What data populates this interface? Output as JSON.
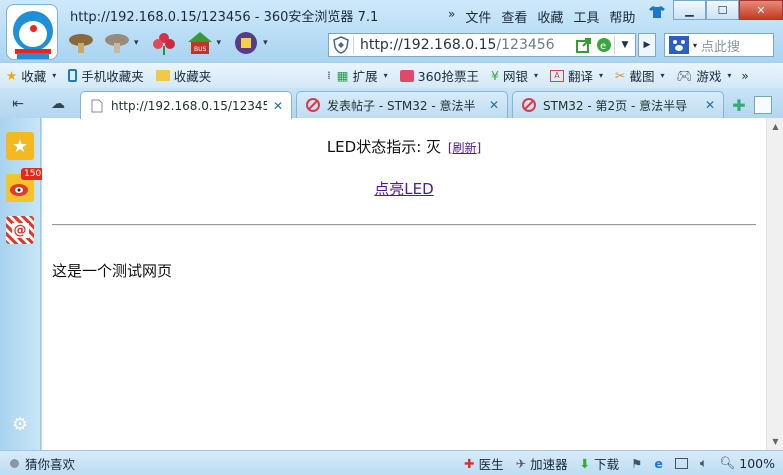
{
  "window": {
    "title": "http://192.168.0.15/123456 - 360安全浏览器 7.1",
    "menus": [
      "文件",
      "查看",
      "收藏",
      "工具",
      "帮助"
    ],
    "minimize_icon": "minimize-icon",
    "maximize_icon": "maximize-icon",
    "close_icon": "close-icon"
  },
  "address_bar": {
    "url_host": "http://192.168.0.15",
    "url_path": "/123456",
    "search_placeholder": "点此搜"
  },
  "favorites_bar": {
    "items": [
      {
        "label": "收藏",
        "icon": "star-add-icon"
      },
      {
        "label": "手机收藏夹",
        "icon": "phone-icon"
      },
      {
        "label": "收藏夹",
        "icon": "folder-icon"
      },
      {
        "label": "扩展",
        "icon": "grid-icon"
      },
      {
        "label": "360抢票王",
        "icon": "ticket-icon"
      },
      {
        "label": "网银",
        "icon": "bank-icon"
      },
      {
        "label": "翻译",
        "icon": "translate-icon"
      },
      {
        "label": "截图",
        "icon": "scissors-icon"
      },
      {
        "label": "游戏",
        "icon": "gamepad-icon"
      }
    ]
  },
  "tabs": [
    {
      "label": "http://192.168.0.15/12345",
      "active": true
    },
    {
      "label": "发表帖子 - STM32 - 意法半",
      "active": false
    },
    {
      "label": "STM32 - 第2页 - 意法半导",
      "active": false
    }
  ],
  "sidebar": {
    "weibo_badge": "150"
  },
  "page": {
    "led_status_label": "LED状态指示: 灭",
    "refresh_link": "[刷新]",
    "light_link": "点亮LED",
    "body_text": "这是一个测试网页"
  },
  "status_bar": {
    "guess_label": "猜你喜欢",
    "doctor_label": "医生",
    "accelerator_label": "加速器",
    "download_label": "下载",
    "zoom_label": "100%"
  }
}
